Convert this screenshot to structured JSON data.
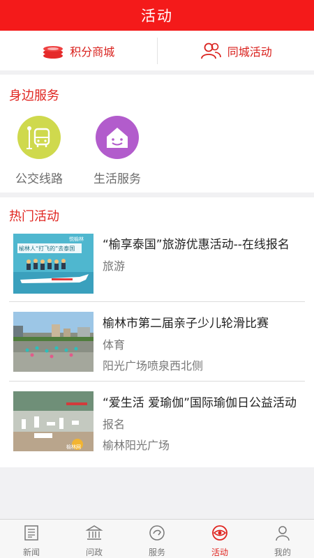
{
  "header": {
    "title": "活动"
  },
  "quick": {
    "points_mall": "积分商城",
    "city_events": "同城活动"
  },
  "nearby": {
    "title": "身边服务",
    "services": [
      {
        "label": "公交线路",
        "icon": "bus-icon",
        "color": "#cfd94d"
      },
      {
        "label": "生活服务",
        "icon": "smiling-house-icon",
        "color": "#b25ccc"
      }
    ]
  },
  "hot": {
    "title": "热门活动",
    "events": [
      {
        "title": "“榆享泰国”旅游优惠活动--在线报名",
        "category": "旅游",
        "location": ""
      },
      {
        "title": "榆林市第二届亲子少儿轮滑比赛",
        "category": "体育",
        "location": "阳光广场喷泉西北侧"
      },
      {
        "title": "“爱生活  爱瑜伽”国际瑜伽日公益活动",
        "category": "报名",
        "location": "榆林阳光广场"
      }
    ],
    "thumb1_text": {
      "line1": "榆林人“打飞的”去泰国",
      "brand": "悦榆林"
    },
    "thumb3_text": {
      "watermark": "榆林网"
    }
  },
  "tabs": [
    {
      "label": "新闻",
      "icon": "newspaper-icon",
      "active": false
    },
    {
      "label": "问政",
      "icon": "government-building-icon",
      "active": false
    },
    {
      "label": "服务",
      "icon": "service-icon",
      "active": false
    },
    {
      "label": "活动",
      "icon": "eye-activity-icon",
      "active": true
    },
    {
      "label": "我的",
      "icon": "person-icon",
      "active": false
    }
  ],
  "colors": {
    "brand_red": "#f41a1a",
    "accent_red": "#e02520"
  }
}
